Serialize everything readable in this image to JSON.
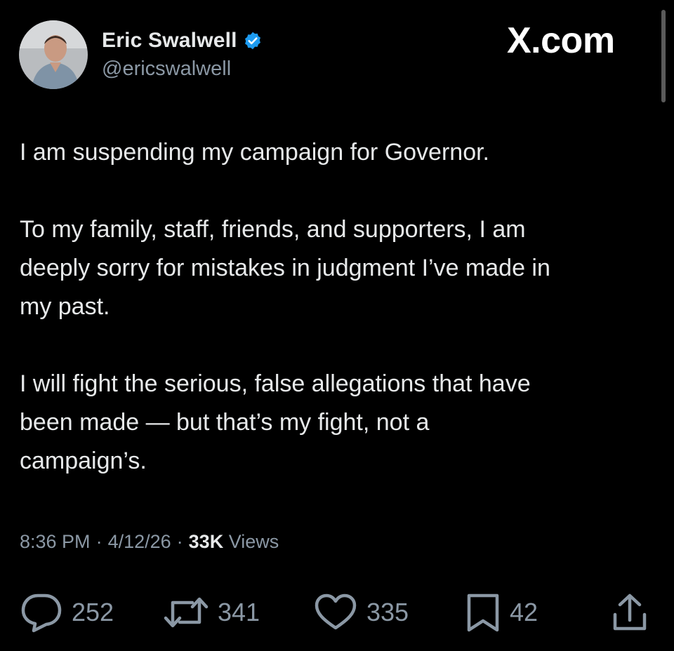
{
  "author": {
    "display_name": "Eric Swalwell",
    "handle": "@ericswalwell",
    "verified": true,
    "verified_color": "#1d9bf0"
  },
  "site_logo": "X.com",
  "post": {
    "paragraphs": [
      "I am suspending my campaign for Governor.",
      "To my family, staff, friends, and supporters, I am\ndeeply sorry for mistakes in judgment I’ve made in\nmy past.",
      "I will fight the serious, false allegations that have\nbeen made — but that’s my fight, not a\ncampaign’s."
    ]
  },
  "meta": {
    "time": "8:36 PM",
    "date": "4/12/26",
    "separator": "·",
    "views_count": "33K",
    "views_label": "Views"
  },
  "actions": {
    "reply": {
      "icon": "reply-icon",
      "count": "252"
    },
    "repost": {
      "icon": "repost-icon",
      "count": "341"
    },
    "like": {
      "icon": "heart-icon",
      "count": "335"
    },
    "bookmark": {
      "icon": "bookmark-icon",
      "count": "42"
    },
    "share": {
      "icon": "share-icon"
    }
  },
  "colors": {
    "background": "#000000",
    "text_primary": "#e7e9ea",
    "text_secondary": "#8b98a5"
  }
}
